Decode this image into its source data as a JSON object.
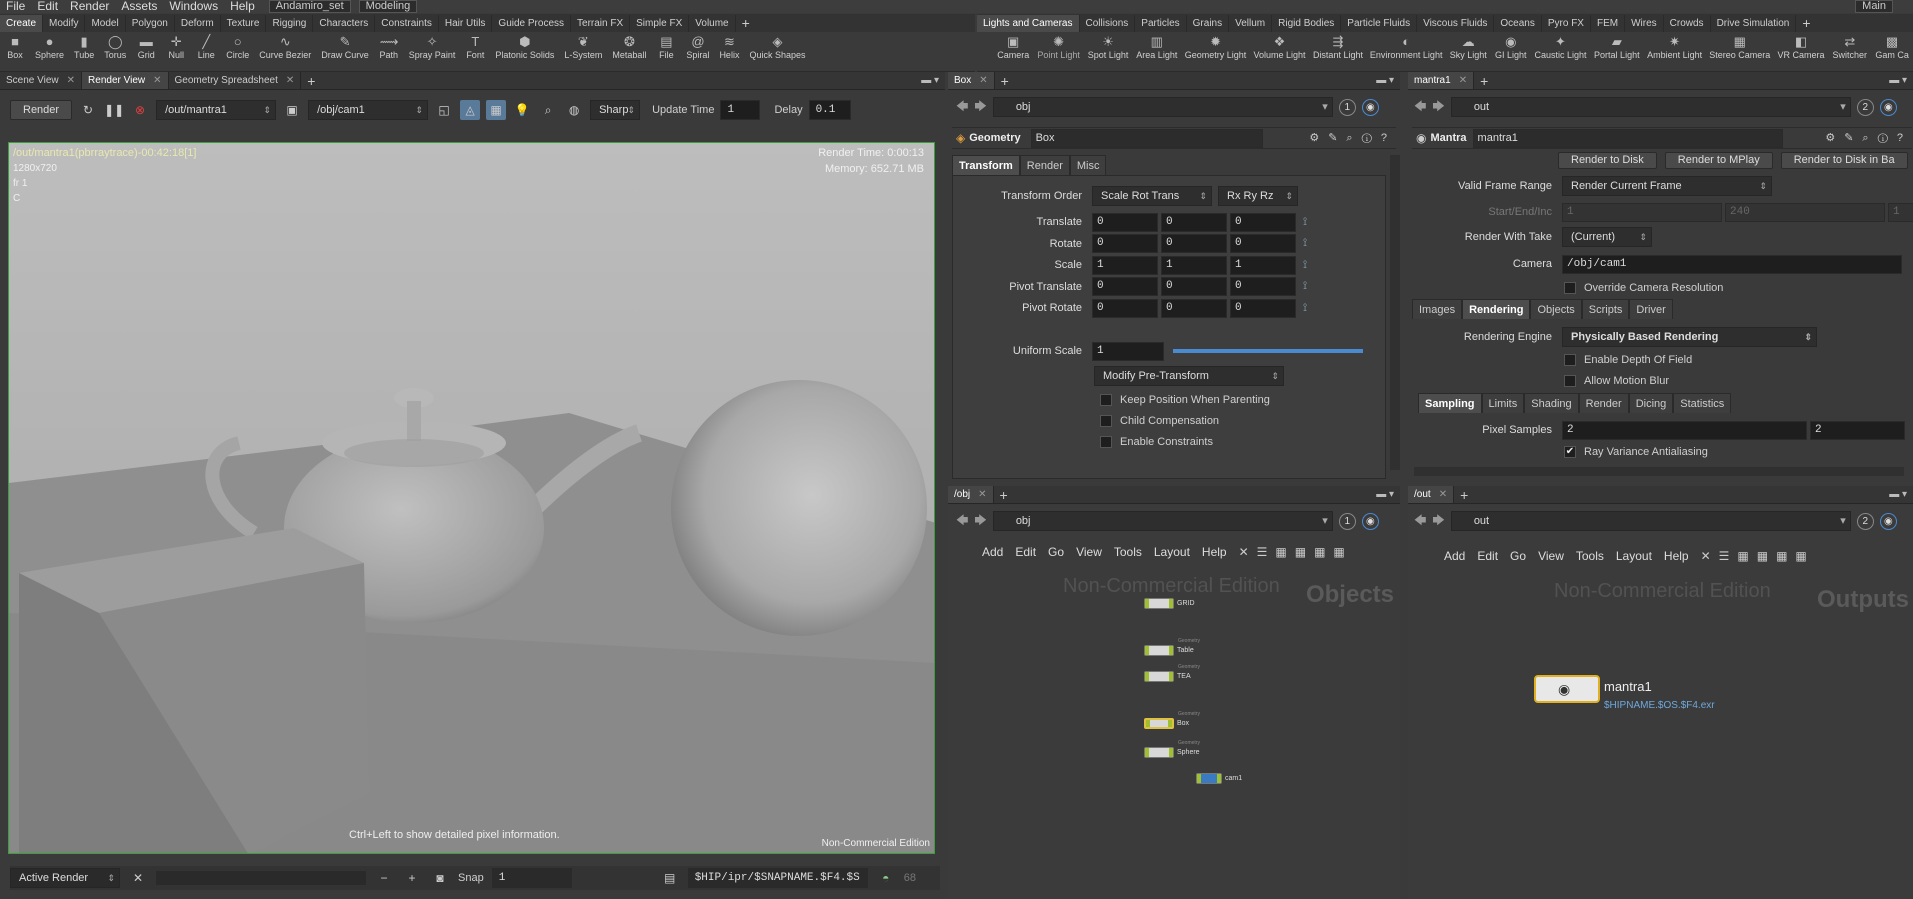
{
  "menubar": {
    "items": [
      "File",
      "Edit",
      "Render",
      "Assets",
      "Windows",
      "Help"
    ],
    "desktop": "Andamiro_set",
    "mode": "Modeling",
    "right_combo": "Main"
  },
  "shelf_left_tabs": [
    "Create",
    "Modify",
    "Model",
    "Polygon",
    "Deform",
    "Texture",
    "Rigging",
    "Characters",
    "Constraints",
    "Hair Utils",
    "Guide Process",
    "Terrain FX",
    "Simple FX",
    "Volume"
  ],
  "shelf_right_tabs": [
    "Lights and Cameras",
    "Collisions",
    "Particles",
    "Grains",
    "Vellum",
    "Rigid Bodies",
    "Particle Fluids",
    "Viscous Fluids",
    "Oceans",
    "Pyro FX",
    "FEM",
    "Wires",
    "Crowds",
    "Drive Simulation"
  ],
  "tools_left": [
    {
      "label": "Box",
      "icon": "■"
    },
    {
      "label": "Sphere",
      "icon": "●"
    },
    {
      "label": "Tube",
      "icon": "▮"
    },
    {
      "label": "Torus",
      "icon": "◯"
    },
    {
      "label": "Grid",
      "icon": "▬"
    },
    {
      "label": "Null",
      "icon": "✛"
    },
    {
      "label": "Line",
      "icon": "╱"
    },
    {
      "label": "Circle",
      "icon": "○"
    },
    {
      "label": "Curve Bezier",
      "icon": "∿"
    },
    {
      "label": "Draw Curve",
      "icon": "✎"
    },
    {
      "label": "Path",
      "icon": "⟿"
    },
    {
      "label": "Spray Paint",
      "icon": "✧"
    },
    {
      "label": "Font",
      "icon": "T"
    },
    {
      "label": "Platonic Solids",
      "icon": "⬢"
    },
    {
      "label": "L-System",
      "icon": "❦"
    },
    {
      "label": "Metaball",
      "icon": "❂"
    },
    {
      "label": "File",
      "icon": "▤"
    },
    {
      "label": "Spiral",
      "icon": "@"
    },
    {
      "label": "Helix",
      "icon": "≋"
    },
    {
      "label": "Quick Shapes",
      "icon": "◈"
    }
  ],
  "tools_right": [
    {
      "label": "Camera",
      "icon": "▣",
      "dim": false
    },
    {
      "label": "Point Light",
      "icon": "✺",
      "dim": true
    },
    {
      "label": "Spot Light",
      "icon": "☀",
      "dim": false
    },
    {
      "label": "Area Light",
      "icon": "▥",
      "dim": false
    },
    {
      "label": "Geometry Light",
      "icon": "✹",
      "dim": false
    },
    {
      "label": "Volume Light",
      "icon": "❖",
      "dim": false
    },
    {
      "label": "Distant Light",
      "icon": "⇶",
      "dim": false
    },
    {
      "label": "Environment Light",
      "icon": "◐",
      "dim": false
    },
    {
      "label": "Sky Light",
      "icon": "☁",
      "dim": false
    },
    {
      "label": "GI Light",
      "icon": "◉",
      "dim": false
    },
    {
      "label": "Caustic Light",
      "icon": "✦",
      "dim": false
    },
    {
      "label": "Portal Light",
      "icon": "▰",
      "dim": false
    },
    {
      "label": "Ambient Light",
      "icon": "✷",
      "dim": false
    },
    {
      "label": "Stereo Camera",
      "icon": "▦",
      "dim": false
    },
    {
      "label": "VR Camera",
      "icon": "◧",
      "dim": false
    },
    {
      "label": "Switcher",
      "icon": "⇄",
      "dim": false
    },
    {
      "label": "Gam Ca",
      "icon": "▩",
      "dim": false
    }
  ],
  "left_pane": {
    "tabs": [
      "Scene View",
      "Render View",
      "Geometry Spreadsheet"
    ],
    "active_tab": "Render View",
    "render_button": "Render",
    "output_path": "/out/mantra1",
    "camera_path": "/obj/cam1",
    "filter": "Sharp",
    "update_time_label": "Update Time",
    "update_time_value": "1",
    "delay_label": "Delay",
    "delay_value": "0.1",
    "overlay_title": "/out/mantra1(pbrraytrace)-00:42:18[1]",
    "overlay_res": "1280x720",
    "overlay_frame": "fr 1",
    "overlay_c": "C",
    "render_time": "Render Time: 0:00:13",
    "memory": "Memory:   652.71 MB",
    "hint": "Ctrl+Left to show detailed pixel information.",
    "watermark": "Non-Commercial Edition",
    "active_render": "Active Render",
    "snap_label": "Snap",
    "snap_value": "1",
    "snap_path": "$HIP/ipr/$SNAPNAME.$F4.$S",
    "frame_count": "68"
  },
  "geo_pane": {
    "tab": "Box",
    "path": "obj",
    "badge": "1",
    "type": "Geometry",
    "name": "Box",
    "tabs": [
      "Transform",
      "Render",
      "Misc"
    ],
    "transform_order_label": "Transform Order",
    "transform_order": "Scale Rot Trans",
    "rot_order": "Rx Ry Rz",
    "params": [
      {
        "label": "Translate",
        "values": [
          "0",
          "0",
          "0"
        ]
      },
      {
        "label": "Rotate",
        "values": [
          "0",
          "0",
          "0"
        ]
      },
      {
        "label": "Scale",
        "values": [
          "1",
          "1",
          "1"
        ]
      },
      {
        "label": "Pivot Translate",
        "values": [
          "0",
          "0",
          "0"
        ]
      },
      {
        "label": "Pivot Rotate",
        "values": [
          "0",
          "0",
          "0"
        ]
      }
    ],
    "uniform_scale_label": "Uniform Scale",
    "uniform_scale": "1",
    "modify_pre": "Modify Pre-Transform",
    "checks": [
      "Keep Position When Parenting",
      "Child Compensation",
      "Enable Constraints"
    ]
  },
  "mantra_pane": {
    "tab": "mantra1",
    "path": "out",
    "badge": "2",
    "type": "Mantra",
    "name": "mantra1",
    "buttons": [
      "Render to Disk",
      "Render to MPlay",
      "Render to Disk in Ba"
    ],
    "valid_frame_label": "Valid Frame Range",
    "valid_frame": "Render Current Frame",
    "start_end_label": "Start/End/Inc",
    "start_end": [
      "1",
      "240",
      "1"
    ],
    "take_label": "Render With Take",
    "take": "(Current)",
    "camera_label": "Camera",
    "camera": "/obj/cam1",
    "override_res": "Override Camera Resolution",
    "tabs": [
      "Images",
      "Rendering",
      "Objects",
      "Scripts",
      "Driver"
    ],
    "engine_label": "Rendering Engine",
    "engine": "Physically Based Rendering",
    "dof": "Enable Depth Of Field",
    "motion_blur": "Allow Motion Blur",
    "subtabs": [
      "Sampling",
      "Limits",
      "Shading",
      "Render",
      "Dicing",
      "Statistics"
    ],
    "pixel_samples_label": "Pixel Samples",
    "pixel_samples": [
      "2",
      "2"
    ],
    "ray_variance": "Ray Variance Antialiasing"
  },
  "obj_network": {
    "tab": "/obj",
    "path": "obj",
    "badge": "1",
    "menu": [
      "Add",
      "Edit",
      "Go",
      "View",
      "Tools",
      "Layout",
      "Help"
    ],
    "watermark": "Non-Commercial Edition",
    "context": "Objects",
    "nodes": [
      {
        "name": "GRID",
        "type": ""
      },
      {
        "name": "Table",
        "type": "Geometry"
      },
      {
        "name": "TEA",
        "type": "Geometry"
      },
      {
        "name": "Box",
        "type": "Geometry"
      },
      {
        "name": "Sphere",
        "type": "Geometry"
      },
      {
        "name": "cam1",
        "type": ""
      }
    ]
  },
  "out_network": {
    "tab": "/out",
    "path": "out",
    "badge": "2",
    "menu": [
      "Add",
      "Edit",
      "Go",
      "View",
      "Tools",
      "Layout",
      "Help"
    ],
    "watermark": "Non-Commercial Edition",
    "context": "Outputs",
    "node_name": "mantra1",
    "node_output": "$HIPNAME.$OS.$F4.exr"
  }
}
